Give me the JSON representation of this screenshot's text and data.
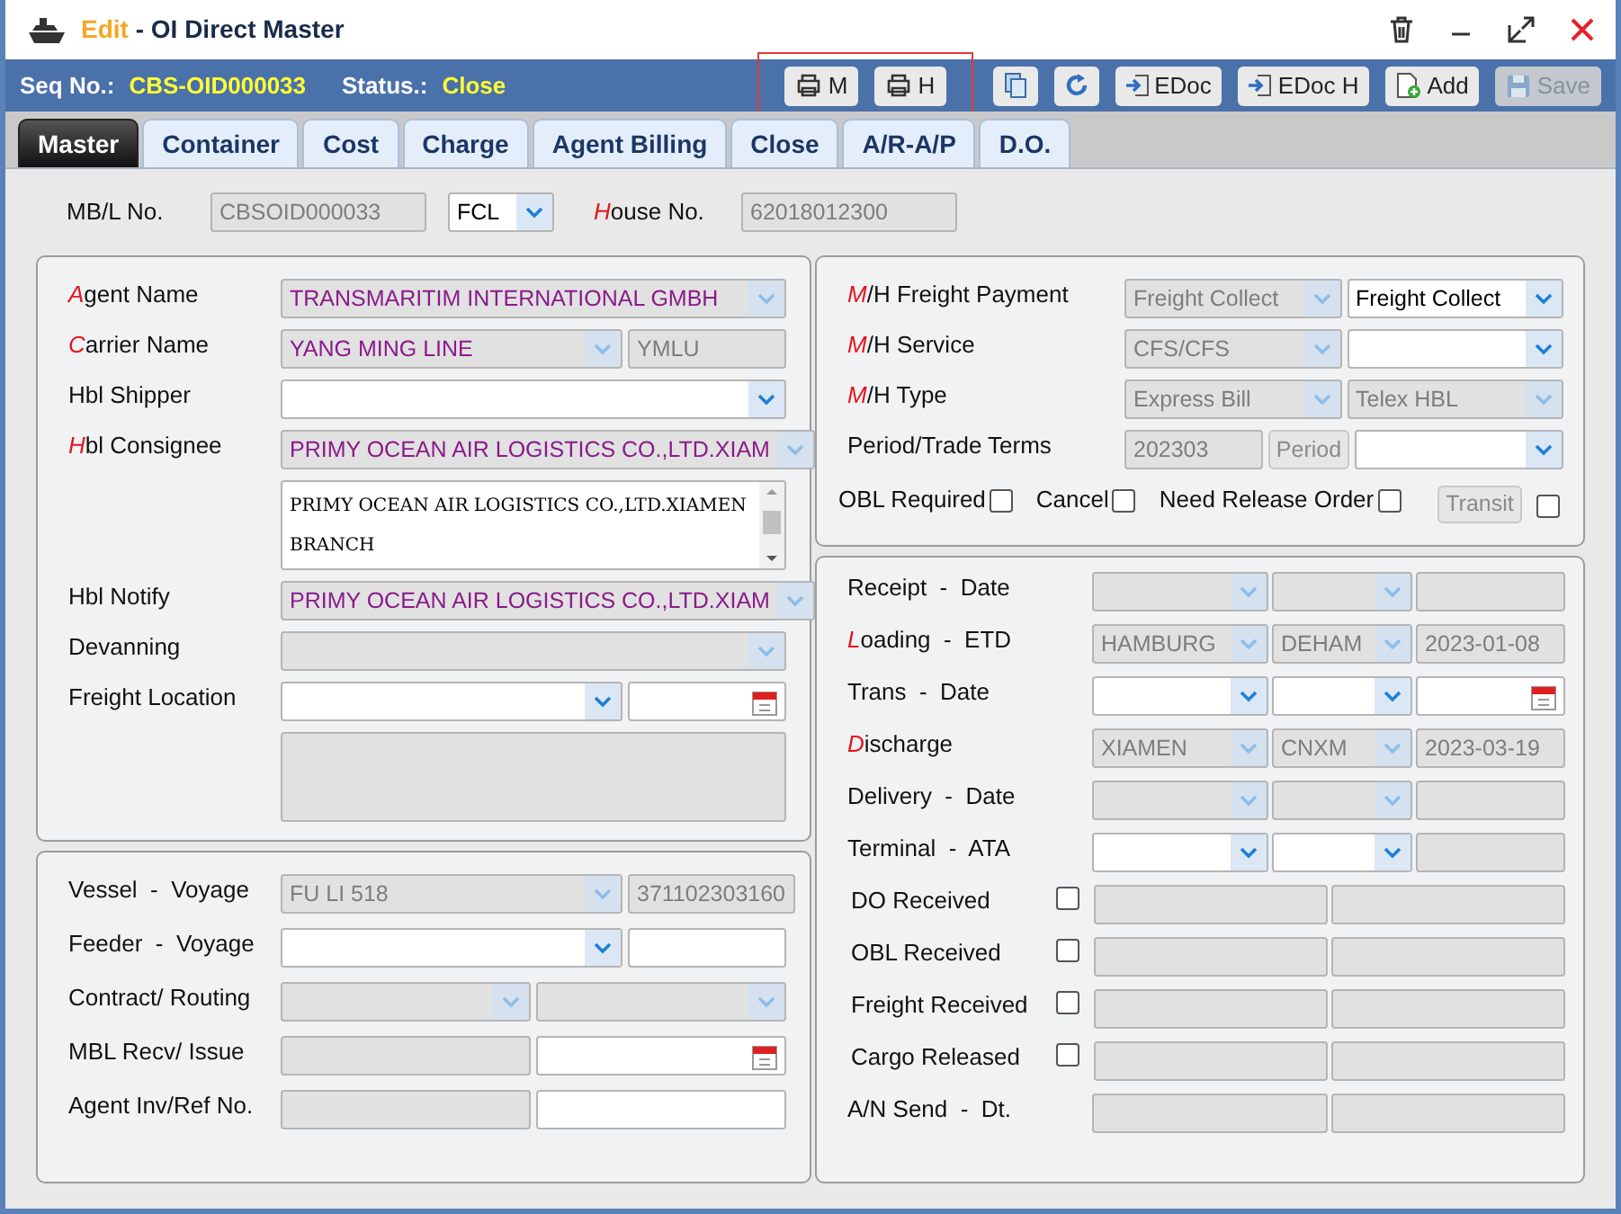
{
  "window": {
    "title_prefix": "Edit",
    "title": " - OI Direct Master"
  },
  "info": {
    "seq_label": "Seq No.:",
    "seq_value": "CBS-OID000033",
    "status_label": "Status.:",
    "status_value": "Close"
  },
  "toolbar": [
    {
      "kind": "highlight",
      "buttons": [
        {
          "label": "M",
          "disabled": false
        },
        {
          "label": "H",
          "disabled": false
        }
      ]
    },
    {
      "kind": "button",
      "disabled": false
    },
    {
      "kind": "button",
      "disabled": false
    },
    {
      "kind": "button",
      "label": "EDoc",
      "disabled": false
    },
    {
      "kind": "button",
      "label": "EDoc H",
      "disabled": false
    },
    {
      "kind": "button",
      "label": "Add",
      "disabled": false
    },
    {
      "kind": "button",
      "label": "Save",
      "disabled": true
    }
  ],
  "tabs": [
    {
      "label": "Master",
      "selected": true
    },
    {
      "label": "Container",
      "selected": false
    },
    {
      "label": "Cost",
      "selected": false
    },
    {
      "label": "Charge",
      "selected": false
    },
    {
      "label": "Agent Billing",
      "selected": false
    },
    {
      "label": "Close",
      "selected": false
    },
    {
      "label": "A/R-A/P",
      "selected": false
    },
    {
      "label": "D.O.",
      "selected": false
    }
  ],
  "header_row": [
    {
      "label": "MB/L No.",
      "required": false,
      "fields": [
        {
          "kind": "text",
          "disabled": true,
          "value": "CBSOID000033"
        },
        {
          "kind": "select",
          "disabled": false,
          "value": "FCL"
        }
      ]
    },
    {
      "label": "House No.",
      "required": true,
      "fields": [
        {
          "kind": "text",
          "disabled": true,
          "value": "62018012300"
        }
      ]
    }
  ],
  "panels": [
    {
      "rows": [
        {
          "label": "Agent Name",
          "required": true,
          "fields": [
            {
              "kind": "select",
              "disabled": true,
              "linked": true,
              "value": "TRANSMARITIM INTERNATIONAL GMBH"
            }
          ]
        },
        {
          "label": "Carrier Name",
          "required": true,
          "fields": [
            {
              "kind": "select",
              "disabled": true,
              "linked": true,
              "value": "YANG MING LINE"
            },
            {
              "kind": "text",
              "disabled": true,
              "value": "YMLU"
            }
          ]
        },
        {
          "label": "Hbl Shipper",
          "required": false,
          "fields": [
            {
              "kind": "select",
              "disabled": false
            }
          ]
        },
        {
          "label": "Hbl Consignee",
          "required": true,
          "fields": [
            {
              "kind": "select",
              "disabled": true,
              "linked": true,
              "value": "PRIMY OCEAN AIR LOGISTICS CO.,LTD.XIAM"
            }
          ]
        },
        {
          "fields": [
            {
              "kind": "textarea",
              "disabled": false,
              "value": "PRIMY OCEAN AIR LOGISTICS CO.,LTD.XIAMEN BRANCH"
            }
          ]
        },
        {
          "label": "Hbl Notify",
          "required": false,
          "fields": [
            {
              "kind": "select",
              "disabled": true,
              "linked": true,
              "value": "PRIMY OCEAN AIR LOGISTICS CO.,LTD.XIAM"
            }
          ]
        },
        {
          "label": "Devanning",
          "required": false,
          "fields": [
            {
              "kind": "select",
              "disabled": true
            }
          ]
        },
        {
          "label": "Freight Location",
          "required": false,
          "fields": [
            {
              "kind": "select",
              "disabled": false
            },
            {
              "kind": "date",
              "disabled": false
            }
          ]
        },
        {
          "fields": [
            {
              "kind": "textarea",
              "disabled": true
            }
          ]
        }
      ]
    },
    {
      "rows": [
        {
          "label": "Vessel  -  Voyage",
          "required": false,
          "fields": [
            {
              "kind": "select",
              "disabled": true,
              "value": "FU LI 518"
            },
            {
              "kind": "text",
              "disabled": true,
              "value": "371102303160"
            }
          ]
        },
        {
          "label": "Feeder  -  Voyage",
          "required": false,
          "fields": [
            {
              "kind": "select",
              "disabled": false
            },
            {
              "kind": "text",
              "disabled": false
            }
          ]
        },
        {
          "label": "Contract/ Routing",
          "required": false,
          "fields": [
            {
              "kind": "select",
              "disabled": true
            },
            {
              "kind": "select",
              "disabled": true
            }
          ]
        },
        {
          "label": "MBL Recv/ Issue",
          "required": false,
          "fields": [
            {
              "kind": "text",
              "disabled": true
            },
            {
              "kind": "date",
              "disabled": false
            }
          ]
        },
        {
          "label": "Agent Inv/Ref No.",
          "required": false,
          "fields": [
            {
              "kind": "text",
              "disabled": true
            },
            {
              "kind": "text",
              "disabled": false
            }
          ]
        }
      ]
    },
    {
      "rows": [
        {
          "label": "M/H Freight Payment",
          "required": true,
          "fields": [
            {
              "kind": "select",
              "disabled": true,
              "value": "Freight Collect"
            },
            {
              "kind": "select",
              "disabled": false,
              "value": "Freight Collect"
            }
          ]
        },
        {
          "label": "M/H Service",
          "required": true,
          "fields": [
            {
              "kind": "select",
              "disabled": true,
              "value": "CFS/CFS"
            },
            {
              "kind": "select",
              "disabled": false
            }
          ]
        },
        {
          "label": "M/H Type",
          "required": true,
          "fields": [
            {
              "kind": "select",
              "disabled": true,
              "value": "Express Bill"
            },
            {
              "kind": "select",
              "disabled": true,
              "value": "Telex HBL"
            }
          ]
        },
        {
          "label": "Period/Trade Terms",
          "required": false,
          "fields": [
            {
              "kind": "text",
              "disabled": true,
              "value": "202303"
            },
            {
              "kind": "button",
              "disabled": true,
              "value": "Period"
            },
            {
              "kind": "select",
              "disabled": false
            }
          ]
        }
      ],
      "checks": [
        {
          "kind": "checkbox",
          "label": "OBL Required",
          "checked": false
        },
        {
          "kind": "checkbox",
          "label": "Cancel",
          "checked": false
        },
        {
          "kind": "checkbox",
          "label": "Need Release Order",
          "checked": false
        },
        {
          "kind": "button",
          "label": "Transit",
          "disabled": true
        },
        {
          "kind": "checkbox",
          "checked": false
        }
      ]
    },
    {
      "rows": [
        {
          "label": "Receipt  -  Date",
          "required": false,
          "fields": [
            {
              "kind": "select",
              "disabled": true
            },
            {
              "kind": "select",
              "disabled": true
            },
            {
              "kind": "text",
              "disabled": true
            }
          ]
        },
        {
          "label": "Loading  -  ETD",
          "required": true,
          "fields": [
            {
              "kind": "select",
              "disabled": true,
              "value": "HAMBURG"
            },
            {
              "kind": "select",
              "disabled": true,
              "value": "DEHAM"
            },
            {
              "kind": "text",
              "disabled": true,
              "value": "2023-01-08"
            }
          ]
        },
        {
          "label": "Trans  -  Date",
          "required": false,
          "fields": [
            {
              "kind": "select",
              "disabled": false
            },
            {
              "kind": "select",
              "disabled": false
            },
            {
              "kind": "date",
              "disabled": false
            }
          ]
        },
        {
          "label": "Discharge",
          "required": true,
          "fields": [
            {
              "kind": "select",
              "disabled": true,
              "value": "XIAMEN"
            },
            {
              "kind": "select",
              "disabled": true,
              "value": "CNXM"
            },
            {
              "kind": "text",
              "disabled": true,
              "value": "2023-03-19"
            }
          ]
        },
        {
          "label": "Delivery  -  Date",
          "required": false,
          "fields": [
            {
              "kind": "select",
              "disabled": true
            },
            {
              "kind": "select",
              "disabled": true
            },
            {
              "kind": "text",
              "disabled": true
            }
          ]
        },
        {
          "label": "Terminal  -  ATA",
          "required": false,
          "fields": [
            {
              "kind": "select",
              "disabled": false
            },
            {
              "kind": "select",
              "disabled": false
            },
            {
              "kind": "text",
              "disabled": true
            }
          ]
        },
        {
          "label": "DO Received",
          "required": false,
          "checked": false,
          "fields": [
            {
              "kind": "text",
              "disabled": true
            },
            {
              "kind": "text",
              "disabled": true
            }
          ]
        },
        {
          "label": "OBL Received",
          "required": false,
          "checked": false,
          "fields": [
            {
              "kind": "text",
              "disabled": true
            },
            {
              "kind": "text",
              "disabled": true
            }
          ]
        },
        {
          "label": "Freight Received",
          "required": false,
          "checked": false,
          "fields": [
            {
              "kind": "text",
              "disabled": true
            },
            {
              "kind": "text",
              "disabled": true
            }
          ]
        },
        {
          "label": "Cargo Released",
          "required": false,
          "checked": false,
          "fields": [
            {
              "kind": "text",
              "disabled": true
            },
            {
              "kind": "text",
              "disabled": true
            }
          ]
        },
        {
          "label": "A/N Send  -  Dt.",
          "required": false,
          "fields": [
            {
              "kind": "text",
              "disabled": true
            },
            {
              "kind": "text",
              "disabled": true
            }
          ]
        }
      ]
    }
  ]
}
